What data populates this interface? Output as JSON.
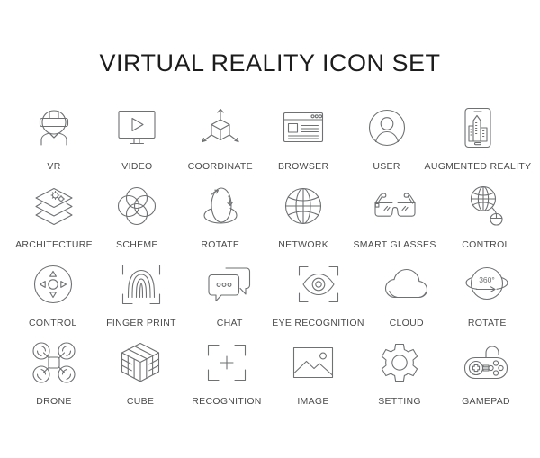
{
  "header": {
    "title": "VIRTUAL REALITY ICON SET"
  },
  "colors": {
    "background": "#ffffff",
    "icon_stroke": "#6e7072",
    "label_text": "#4a4a4a",
    "title_text": "#1c1c1c"
  },
  "rows": [
    {
      "items": [
        {
          "label": "VR",
          "icon": "vr-headset-person-icon"
        },
        {
          "label": "VIDEO",
          "icon": "video-monitor-play-icon"
        },
        {
          "label": "COORDINATE",
          "icon": "coordinate-axes-cube-icon"
        },
        {
          "label": "BROWSER",
          "icon": "browser-window-icon"
        },
        {
          "label": "USER",
          "icon": "user-avatar-circle-icon"
        },
        {
          "label": "AUGMENTED  REALITY",
          "icon": "augmented-reality-phone-icon"
        }
      ]
    },
    {
      "items": [
        {
          "label": "ARCHITECTURE",
          "icon": "architecture-layers-gears-icon"
        },
        {
          "label": "SCHEME",
          "icon": "scheme-four-circles-icon"
        },
        {
          "label": "ROTATE",
          "icon": "rotate-ellipse-arrows-icon"
        },
        {
          "label": "NETWORK",
          "icon": "network-globe-icon"
        },
        {
          "label": "SMART  GLASSES",
          "icon": "smart-glasses-icon"
        },
        {
          "label": "CONTROL",
          "icon": "control-globe-mouse-icon"
        }
      ]
    },
    {
      "items": [
        {
          "label": "CONTROL",
          "icon": "control-dpad-icon"
        },
        {
          "label": "FINGER  PRINT",
          "icon": "fingerprint-scan-icon"
        },
        {
          "label": "CHAT",
          "icon": "chat-bubbles-icon"
        },
        {
          "label": "EYE  RECOGNITION",
          "icon": "eye-recognition-scan-icon"
        },
        {
          "label": "CLOUD",
          "icon": "cloud-icon"
        },
        {
          "label": "ROTATE",
          "icon": "rotate-360-icon",
          "badge": "360"
        }
      ]
    },
    {
      "items": [
        {
          "label": "DRONE",
          "icon": "drone-quadcopter-icon"
        },
        {
          "label": "CUBE",
          "icon": "cube-rubik-icon"
        },
        {
          "label": "RECOGNITION",
          "icon": "recognition-crosshair-icon"
        },
        {
          "label": "IMAGE",
          "icon": "image-picture-icon"
        },
        {
          "label": "SETTING",
          "icon": "setting-gear-icon"
        },
        {
          "label": "GAMEPAD",
          "icon": "gamepad-controller-icon"
        }
      ]
    }
  ]
}
